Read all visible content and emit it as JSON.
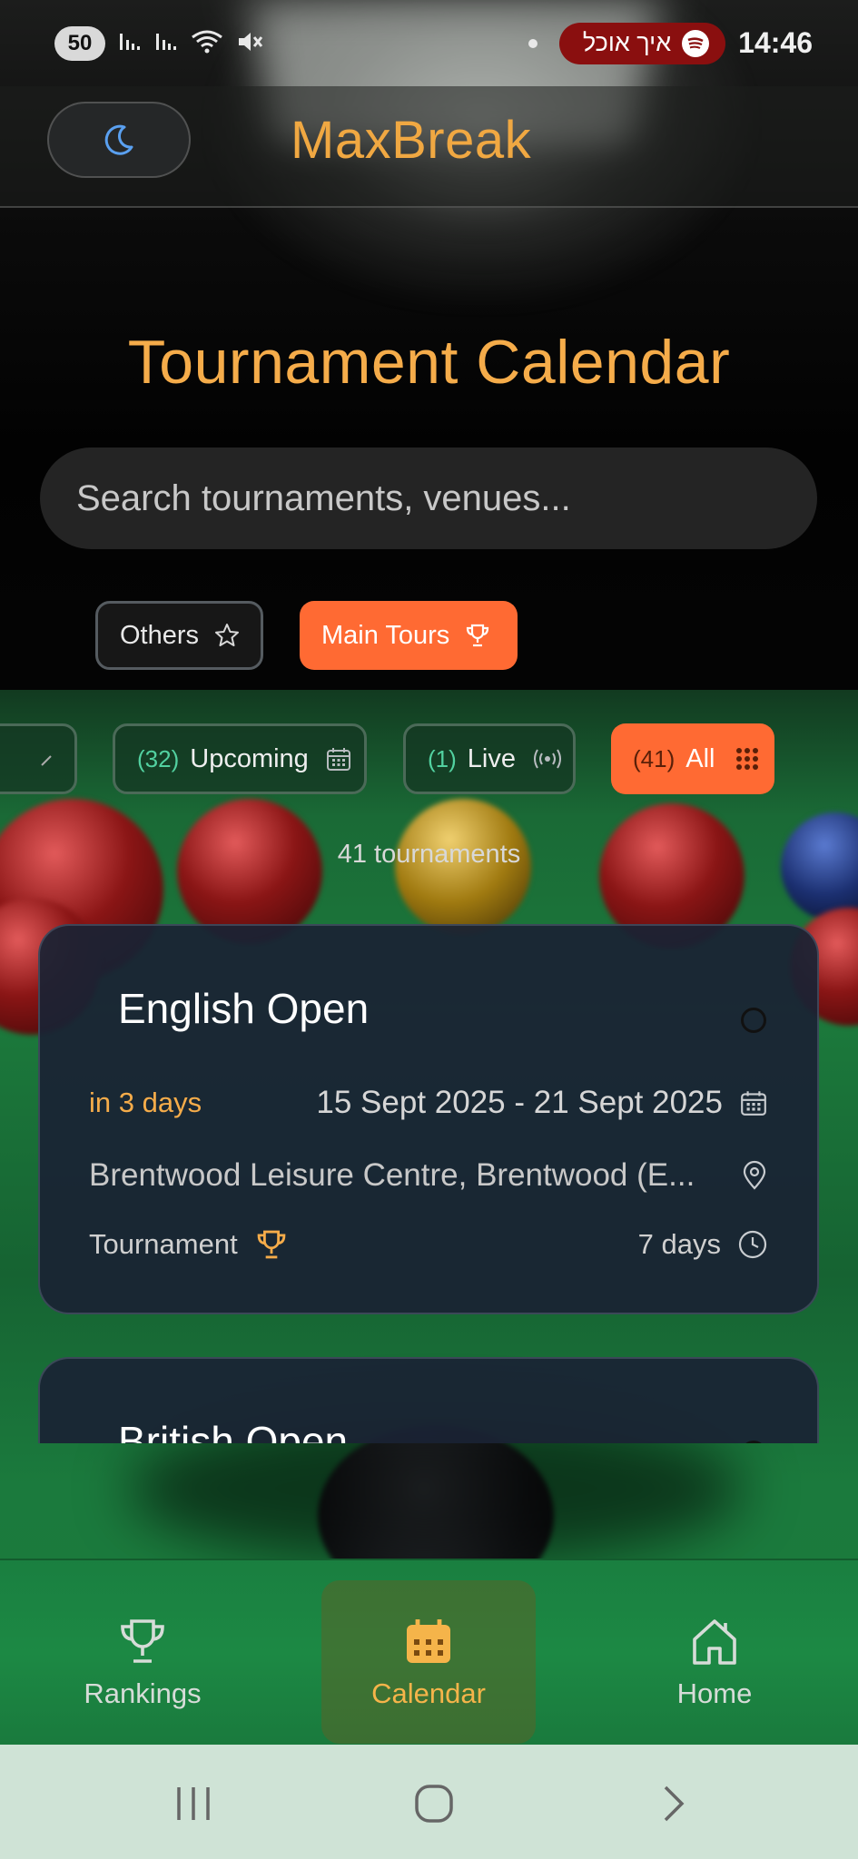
{
  "status_bar": {
    "battery": "50",
    "spotify_text": "איך אוכל",
    "time": "14:46"
  },
  "header": {
    "app_title": "MaxBreak",
    "theme_icon": "moon-icon"
  },
  "page": {
    "title": "Tournament Calendar",
    "search_placeholder": "Search tournaments, venues..."
  },
  "tour_filters": [
    {
      "label": "Others",
      "icon": "star-icon",
      "active": false
    },
    {
      "label": "Main Tours",
      "icon": "trophy-icon",
      "active": true
    }
  ],
  "status_filters": [
    {
      "count": "(32)",
      "label": "Upcoming",
      "icon": "calendar-icon",
      "active": false
    },
    {
      "count": "(1)",
      "label": "Live",
      "icon": "broadcast-icon",
      "active": false
    },
    {
      "count": "(41)",
      "label": "All",
      "icon": "grid-icon",
      "active": true
    }
  ],
  "result_count": "41 tournaments",
  "tournaments": [
    {
      "name": "English Open",
      "countdown": "in 3 days",
      "dates": "15 Sept 2025 - 21 Sept 2025",
      "venue": "Brentwood Leisure Centre, Brentwood (E...",
      "type": "Tournament",
      "duration": "7 days"
    },
    {
      "name": "British Open"
    }
  ],
  "bottom_nav": [
    {
      "label": "Rankings",
      "icon": "trophy-icon",
      "active": false
    },
    {
      "label": "Calendar",
      "icon": "calendar-icon",
      "active": true
    },
    {
      "label": "Home",
      "icon": "home-icon",
      "active": false
    }
  ],
  "colors": {
    "accent": "#ff6a33",
    "title": "#f5ac4a",
    "card_bg": "#1a2234",
    "nav_green": "#1c8944"
  }
}
